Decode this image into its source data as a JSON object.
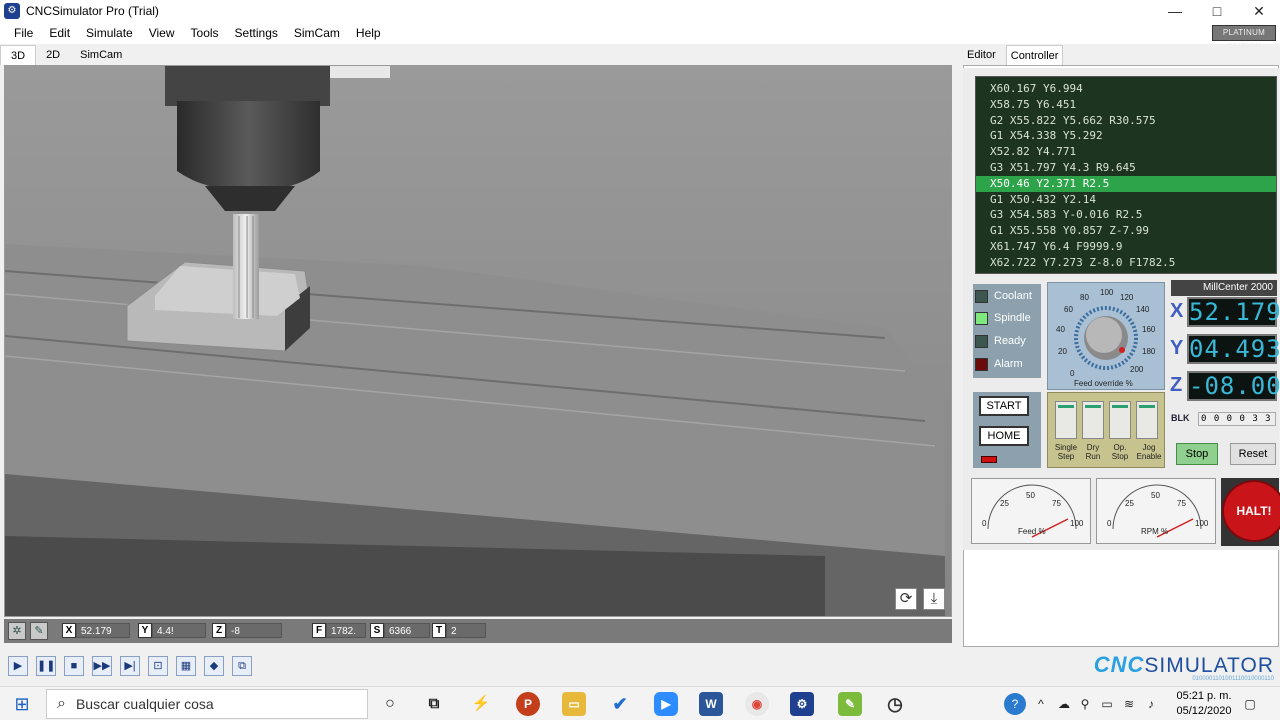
{
  "window": {
    "title": "CNCSimulator Pro (Trial)",
    "icon": "cnc-app-icon",
    "min": "—",
    "max": "□",
    "close": "✕"
  },
  "menu": [
    "File",
    "Edit",
    "Simulate",
    "View",
    "Tools",
    "Settings",
    "SimCam",
    "Help"
  ],
  "edition_badge": "PLATINUM EDITION",
  "view_tabs": [
    "3D",
    "2D",
    "SimCam"
  ],
  "right_tabs": [
    "Editor",
    "Controller"
  ],
  "gcode": [
    "X60.167 Y6.994",
    "X58.75 Y6.451",
    "G2 X55.822 Y5.662 R30.575",
    "G1 X54.338 Y5.292",
    "X52.82 Y4.771",
    "G3 X51.797 Y4.3 R9.645",
    "X50.46 Y2.371 R2.5",
    "G1 X50.432 Y2.14",
    "G3 X54.583 Y-0.016 R2.5",
    "G1 X55.558 Y0.857 Z-7.99",
    "X61.747 Y6.4 F9999.9",
    "X62.722 Y7.273 Z-8.0 F1782.5"
  ],
  "gcode_current_index": 6,
  "indicators": [
    {
      "label": "Coolant",
      "color": "#3d5650"
    },
    {
      "label": "Spindle",
      "color": "#7ee87e"
    },
    {
      "label": "Ready",
      "color": "#3d5650"
    },
    {
      "label": "Alarm",
      "color": "#6b0a0a"
    }
  ],
  "buttons": {
    "start": "START",
    "home": "HOME",
    "stop": "Stop",
    "reset": "Reset",
    "halt": "HALT!"
  },
  "feed_override": {
    "label": "Feed override %",
    "ticks": [
      "0",
      "20",
      "40",
      "60",
      "80",
      "100",
      "120",
      "140",
      "160",
      "180",
      "200"
    ]
  },
  "switches": [
    "Single Step",
    "Dry Run",
    "Op. Stop",
    "Jog Enable"
  ],
  "machine": {
    "name": "MillCenter 2000"
  },
  "dro": {
    "x_label": "X",
    "y_label": "Y",
    "z_label": "Z",
    "x": "52.179",
    "y": "04.493",
    "z": "-08.00"
  },
  "blk": {
    "label": "BLK",
    "value": "0 0 0 0 3 3"
  },
  "gauges": [
    {
      "label": "Feed %",
      "ticks": [
        "0",
        "25",
        "50",
        "75",
        "100"
      ]
    },
    {
      "label": "RPM %",
      "ticks": [
        "0",
        "25",
        "50",
        "75",
        "100"
      ]
    }
  ],
  "status": {
    "x_label": "X",
    "x": "52.179",
    "y_label": "Y",
    "y": "4.4!",
    "z_label": "Z",
    "z": "-8",
    "f_label": "F",
    "f": "1782.",
    "s_label": "S",
    "s": "6366",
    "t_label": "T",
    "t": "2"
  },
  "logo": {
    "cnc": "CNC",
    "sim": "SIMULATOR",
    "bits": "0100001101001110010000110"
  },
  "taskbar": {
    "search_placeholder": "Buscar cualquier cosa",
    "time": "05:21 p. m.",
    "date": "05/12/2020"
  },
  "colors": {
    "accent": "#2ea44a",
    "lcd_text": "#39b8d8",
    "halt": "#c9141a"
  }
}
